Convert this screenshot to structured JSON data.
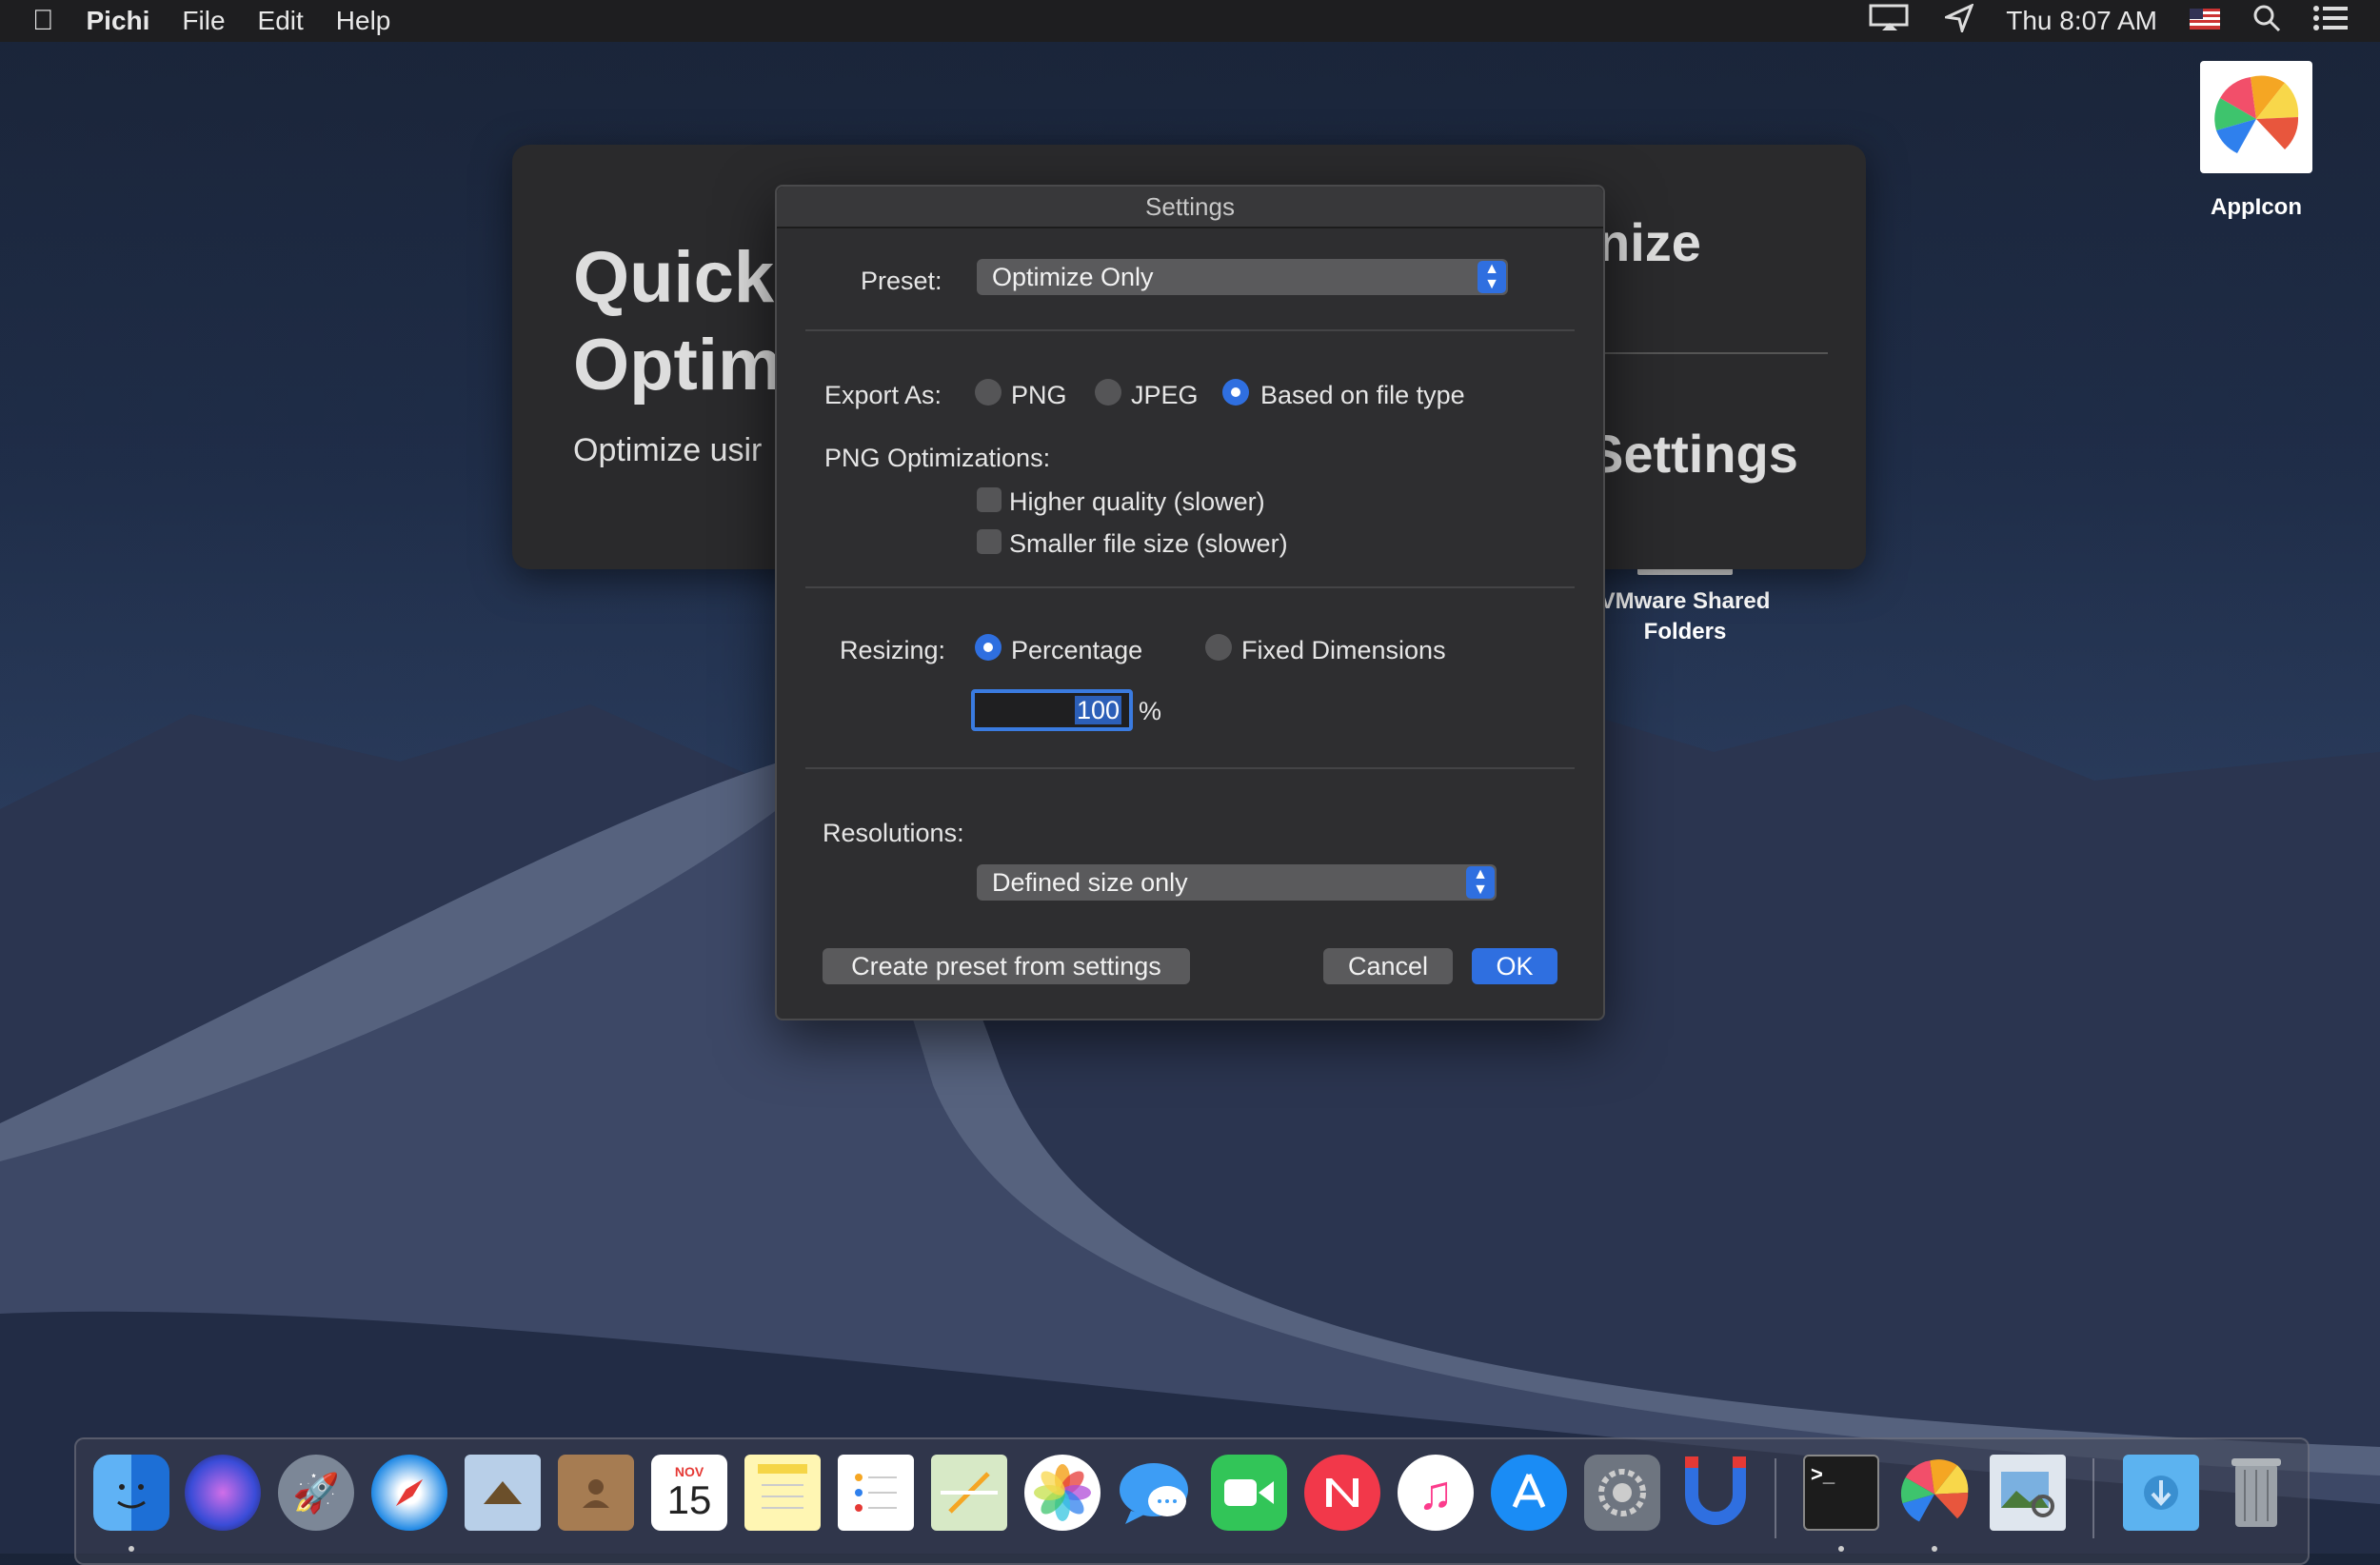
{
  "menubar": {
    "app_name": "Pichi",
    "menus": [
      "File",
      "Edit",
      "Help"
    ],
    "clock": "Thu 8:07 AM"
  },
  "desktop": {
    "appicon_label": "AppIcon",
    "vmware_label_line1": "VMware Shared",
    "vmware_label_line2": "Folders"
  },
  "background_window": {
    "heading_line1": "Quick",
    "heading_line2": "Optim",
    "subtitle": "Optimize usir",
    "heading_right": "nize",
    "settings_right": "Settings"
  },
  "dialog": {
    "title": "Settings",
    "preset_label": "Preset:",
    "preset_value": "Optimize Only",
    "export_label": "Export As:",
    "export_options": [
      "PNG",
      "JPEG",
      "Based on file type"
    ],
    "export_selected": "Based on file type",
    "png_opt_label": "PNG Optimizations:",
    "png_opt_checks": [
      "Higher quality (slower)",
      "Smaller file size (slower)"
    ],
    "resizing_label": "Resizing:",
    "resizing_options": [
      "Percentage",
      "Fixed Dimensions"
    ],
    "resizing_selected": "Percentage",
    "percentage_value": "100",
    "percent_sign": "%",
    "resolutions_label": "Resolutions:",
    "resolutions_value": "Defined size only",
    "create_preset_button": "Create preset from settings",
    "cancel_button": "Cancel",
    "ok_button": "OK"
  },
  "dock": {
    "apps": [
      "Finder",
      "Siri",
      "Launchpad",
      "Safari",
      "Mail",
      "Contacts",
      "Calendar",
      "Notes",
      "Reminders",
      "Maps",
      "Photos",
      "Messages",
      "FaceTime",
      "News",
      "iTunes",
      "App Store",
      "System Preferences",
      "Magnet",
      "Terminal",
      "Pichi",
      "Preview",
      "Downloads",
      "Trash"
    ],
    "calendar_month": "NOV",
    "calendar_day": "15"
  },
  "colors": {
    "accent": "#2f6fe0",
    "dialog_bg": "#2e2e30"
  }
}
